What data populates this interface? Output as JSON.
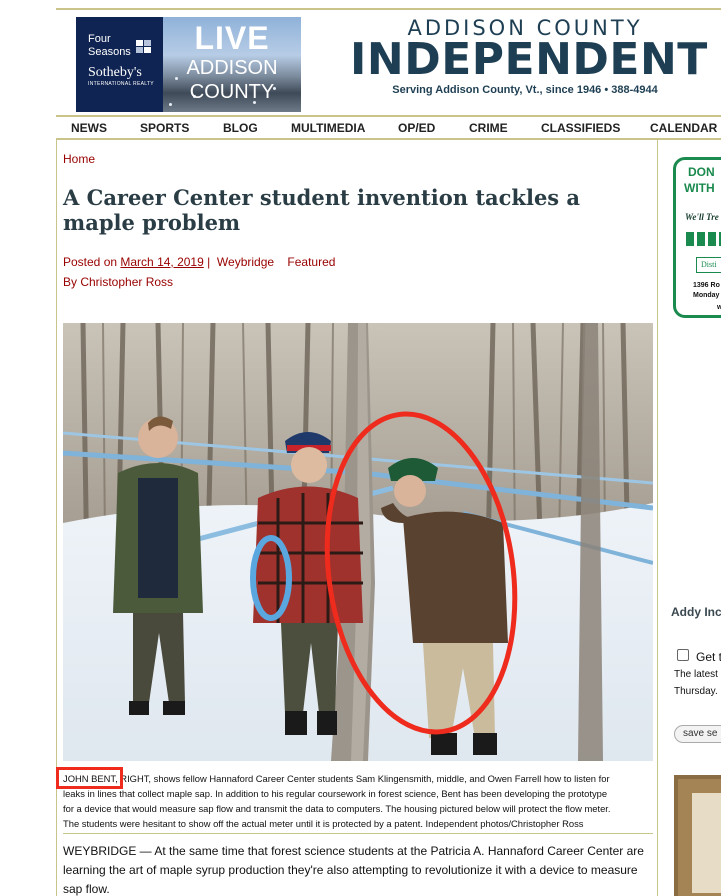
{
  "ad": {
    "brand_line1": "Four",
    "brand_line2": "Seasons",
    "brand_name": "Sotheby's",
    "brand_sub": "INTERNATIONAL REALTY",
    "headline1": "LIVE",
    "headline2": "ADDISON",
    "headline3": "COUNTY"
  },
  "masthead": {
    "top": "ADDISON COUNTY",
    "main": "INDEPENDENT",
    "sub": "Serving Addison County, Vt., since 1946 • 388-4944"
  },
  "nav": {
    "items": [
      "NEWS",
      "SPORTS",
      "BLOG",
      "MULTIMEDIA",
      "OP/ED",
      "CRIME",
      "CLASSIFIEDS",
      "CALENDAR"
    ]
  },
  "article": {
    "breadcrumb": "Home",
    "title": "A Career Center student invention tackles a maple problem",
    "posted_on_label": "Posted on",
    "date": "March 14, 2019",
    "separator": "|",
    "category1": "Weybridge",
    "category2": "Featured",
    "byline": "By Christopher Ross",
    "caption_lines": [
      "JOHN BENT, RIGHT, shows fellow Hannaford Career Center students Sam Klingensmith, middle, and Owen Farrell how to listen for",
      "leaks in lines that collect maple sap. In addition to his regular coursework in forest science, Bent has been developing the prototype",
      "for a device that would measure sap flow and transmit the data to computers. The housing pictured below will protect the flow meter.",
      "The students were hesitant to show off the actual meter until it is protected by a patent. Independent photos/Christopher Ross"
    ],
    "body_lines": [
      "WEYBRIDGE — At the same time that forest science students at the Patricia A. Hannaford Career Center are",
      "learning the art of maple syrup production they're also attempting to revolutionize it with a device to measure",
      "sap flow."
    ]
  },
  "sidebar": {
    "ad_line1": "DON",
    "ad_line2": "WITH",
    "ad_line3": "I",
    "ad_tagline": "We'll Tre",
    "ad_dist": "Disti",
    "ad_addr1": "1396 Ro",
    "ad_addr2": "Monday",
    "ad_addr3": "w",
    "heading": "Addy Inc",
    "checkbox_label": "Get t",
    "desc1": "The latest",
    "desc2": "Thursday.",
    "save_label": "save se"
  },
  "colors": {
    "brand_navy": "#1e3f53",
    "link_red": "#990000",
    "rule_olive": "#c9c48a",
    "annotation_red": "#ee2b1c",
    "ad_green": "#1a8a4e"
  }
}
